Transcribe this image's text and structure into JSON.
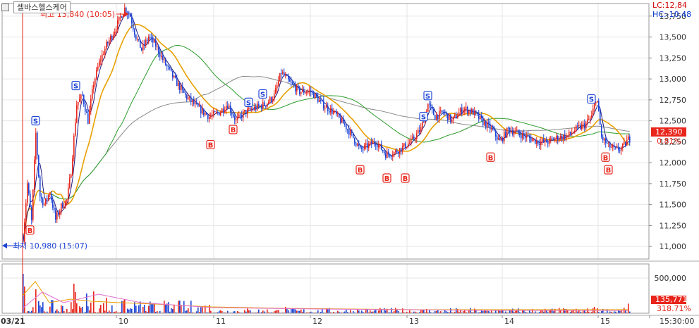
{
  "header": {
    "stock_name": "셀바스헬스케어",
    "lc_label": "LC:12,84",
    "hc_label": "HC:-10,48"
  },
  "annotations": {
    "high": "최고 13,840 (10:05)",
    "low": "최저 10,980 (15:07)"
  },
  "colors": {
    "up": "#e8261c",
    "down": "#1f45d6",
    "ma_short": "#e8a000",
    "ma_mid": "#2a9a2a",
    "ma_long": "#888888",
    "ma_fast": "#1a1a80"
  },
  "chart_data": {
    "type": "candlestick",
    "price_axis": {
      "ticks": [
        "13,750",
        "13,500",
        "13,250",
        "13,000",
        "12,750",
        "12,500",
        "12,250",
        "12,000",
        "11,750",
        "11,500",
        "11,250",
        "11,000"
      ],
      "range": [
        10850,
        13900
      ]
    },
    "volume_axis": {
      "ticks": [
        "500,000"
      ],
      "range": [
        0,
        700000
      ]
    },
    "x_ticks": [
      "03/21",
      "10",
      "11",
      "12",
      "13",
      "14",
      "15",
      "15:30:00"
    ],
    "current_price": "12,390",
    "current_change_pct": "0.81%",
    "current_volume": "135,771",
    "volume_ratio": "318.71%",
    "high": 13840,
    "low": 10980,
    "signals": [
      {
        "type": "B",
        "price": 11280,
        "session_index": 0
      },
      {
        "type": "S",
        "price": 12400,
        "session_index": 0
      },
      {
        "type": "B",
        "price": 12300,
        "session_index": 1
      },
      {
        "type": "S",
        "price": 12820,
        "session_index": 1
      },
      {
        "type": "B",
        "price": 12480,
        "session_index": 1
      },
      {
        "type": "S",
        "price": 12620,
        "session_index": 2
      },
      {
        "type": "S",
        "price": 12720,
        "session_index": 2
      },
      {
        "type": "B",
        "price": 12000,
        "session_index": 2
      },
      {
        "type": "B",
        "price": 11900,
        "session_index": 3
      },
      {
        "type": "B",
        "price": 11900,
        "session_index": 3
      },
      {
        "type": "S",
        "price": 12700,
        "session_index": 3
      },
      {
        "type": "S",
        "price": 12450,
        "session_index": 3
      },
      {
        "type": "B",
        "price": 12150,
        "session_index": 4
      },
      {
        "type": "S",
        "price": 12660,
        "session_index": 6
      },
      {
        "type": "B",
        "price": 12150,
        "session_index": 6
      },
      {
        "type": "B",
        "price": 12000,
        "session_index": 6
      }
    ]
  }
}
